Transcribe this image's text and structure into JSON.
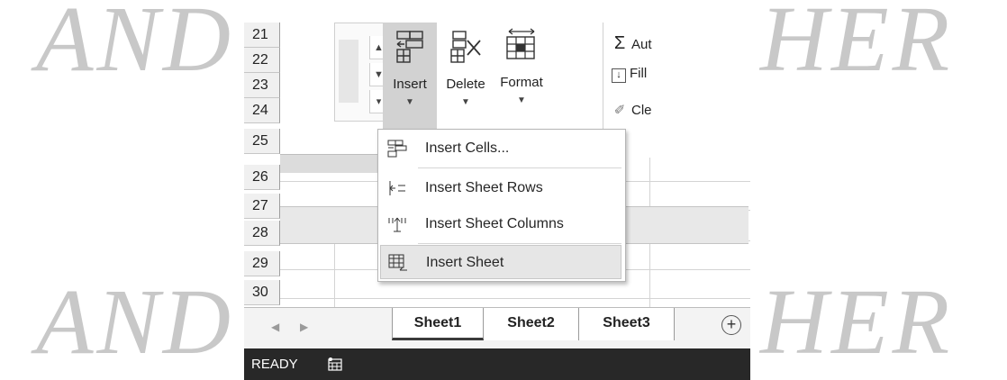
{
  "watermark": "ANDI PUBLISHER",
  "rows": [
    "21",
    "22",
    "23",
    "24",
    "25",
    "26",
    "27",
    "28",
    "29",
    "30"
  ],
  "ribbon": {
    "insert_label": "Insert",
    "delete_label": "Delete",
    "format_label": "Format",
    "autosum_label": "Aut",
    "fill_label": "Fill",
    "clear_label": "Cle"
  },
  "insert_menu": {
    "items": [
      {
        "label": "Insert Cells...",
        "icon": "insert-cells-icon"
      },
      {
        "label": "Insert Sheet Rows",
        "icon": "insert-rows-icon"
      },
      {
        "label": "Insert Sheet Columns",
        "icon": "insert-columns-icon"
      },
      {
        "label": "Insert Sheet",
        "icon": "insert-sheet-icon",
        "highlighted": true
      }
    ]
  },
  "sheet_tabs": [
    "Sheet1",
    "Sheet2",
    "Sheet3"
  ],
  "active_sheet": "Sheet1",
  "status": {
    "ready": "READY"
  },
  "colors": {
    "status_bar": "#282828",
    "active_button": "#d2d2d2",
    "watermark": "#c8c8c8"
  }
}
